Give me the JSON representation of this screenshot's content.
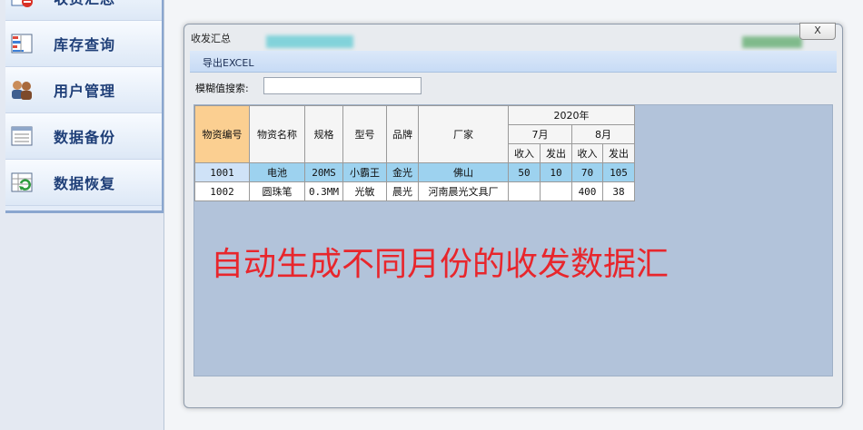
{
  "sidebar": {
    "items": [
      {
        "label": "收货汇总",
        "icon": "minus-badge-icon"
      },
      {
        "label": "库存查询",
        "icon": "inventory-chart-icon"
      },
      {
        "label": "用户管理",
        "icon": "users-icon"
      },
      {
        "label": "数据备份",
        "icon": "document-list-icon"
      },
      {
        "label": "数据恢复",
        "icon": "spreadsheet-refresh-icon"
      }
    ]
  },
  "dialog": {
    "title": "收发汇总",
    "close_label": "X",
    "export_label": "导出EXCEL",
    "search_label": "模糊值搜索:",
    "search_value": ""
  },
  "table": {
    "headers": [
      "物资编号",
      "物资名称",
      "规格",
      "型号",
      "品牌",
      "厂家"
    ],
    "year": "2020年",
    "months": [
      "7月",
      "8月"
    ],
    "sub_headers": [
      "收入",
      "发出",
      "收入",
      "发出"
    ],
    "rows": [
      {
        "id": "1001",
        "name": "电池",
        "spec": "20MS",
        "model": "小霸王",
        "brand": "金光",
        "maker": "佛山",
        "m7_in": "50",
        "m7_out": "10",
        "m8_in": "70",
        "m8_out": "105"
      },
      {
        "id": "1002",
        "name": "圆珠笔",
        "spec": "0.3MM",
        "model": "光敏",
        "brand": "晨光",
        "maker": "河南晨光文具厂",
        "m7_in": "",
        "m7_out": "",
        "m8_in": "400",
        "m8_out": "38"
      }
    ]
  },
  "annotation": "自动生成不同月份的收发数据汇",
  "colors": {
    "annotation": "#e8262c",
    "selected_row": "#9dd2ef",
    "header_first": "#fbcf91",
    "grid_bg": "#b2c3da"
  }
}
